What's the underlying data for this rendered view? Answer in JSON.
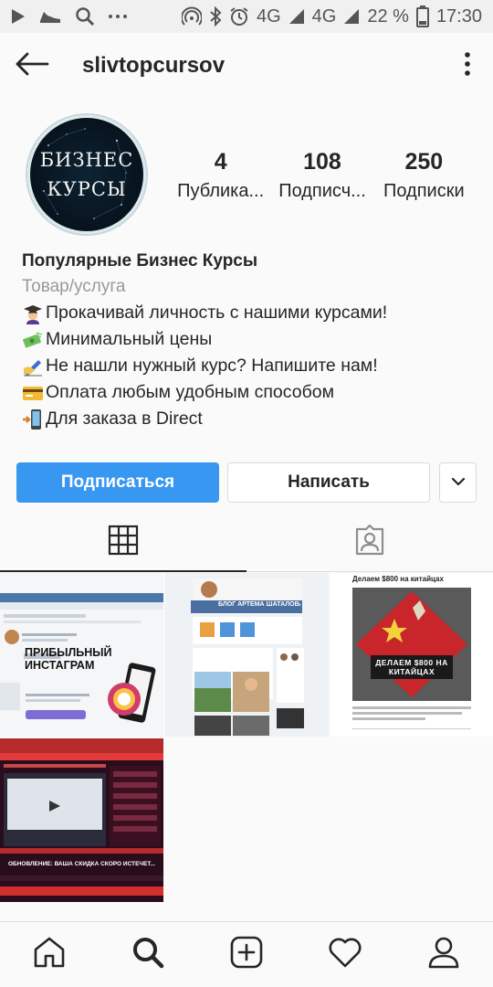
{
  "status_bar": {
    "signal_1": "4G",
    "signal_2": "4G",
    "signal_2_sup": "4G",
    "battery": "22 %",
    "time": "17:30"
  },
  "header": {
    "username": "slivtopcursov",
    "back_icon": "arrow-left-icon",
    "more_icon": "vertical-dots-icon"
  },
  "profile": {
    "avatar_line_1": "БИЗНЕС",
    "avatar_line_2": "КУРСЫ",
    "stats": [
      {
        "value": "4",
        "label": "Публика..."
      },
      {
        "value": "108",
        "label": "Подписч..."
      },
      {
        "value": "250",
        "label": "Подписки"
      }
    ]
  },
  "bio": {
    "name": "Популярные Бизнес Курсы",
    "category": "Товар/услуга",
    "lines": [
      {
        "icon": "graduate-emoji",
        "text": "Прокачивай личность с нашими курсами!"
      },
      {
        "icon": "money-emoji",
        "text": "Минимальный цены"
      },
      {
        "icon": "writing-hand-emoji",
        "text": "Не нашли нужный курс? Напишите нам!"
      },
      {
        "icon": "credit-card-emoji",
        "text": "Оплата любым удобным способом"
      },
      {
        "icon": "phone-arrow-emoji",
        "text": "Для заказа в Direct"
      }
    ]
  },
  "actions": {
    "follow": "Подписаться",
    "message": "Написать"
  },
  "posts": [
    {
      "title": "ПРИБЫЛЬНЫЙ ИНСТАГРАМ"
    },
    {
      "title": "БЛОГ АРТЕМА ШАТАЛОВА"
    },
    {
      "title": "Делаем $800 на китайцах",
      "overlay": "ДЕЛАЕМ $800 НА КИТАЙЦАХ"
    },
    {
      "title": "ОБНОВЛЕНИЕ: ВАША СКИДКА СКОРО ИСТЕЧЕТ..."
    }
  ],
  "colors": {
    "accent": "#3897f0",
    "text": "#262626",
    "muted": "#999999",
    "border": "#dbdbdb"
  }
}
